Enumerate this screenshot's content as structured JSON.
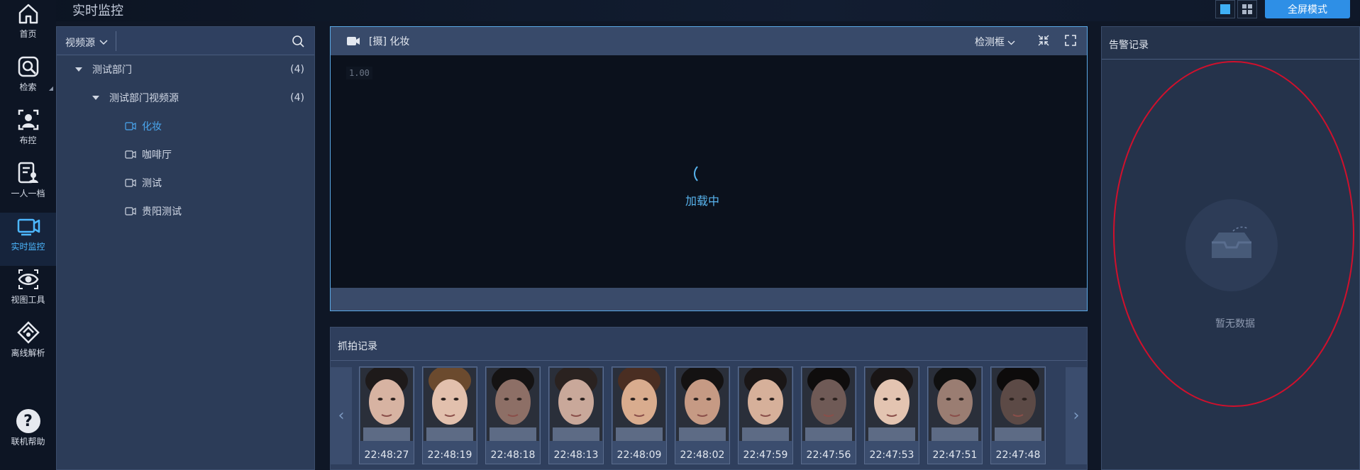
{
  "header": {
    "title": "实时监控",
    "fullscreen_label": "全屏模式",
    "layout_options": [
      "single-view",
      "grid-view"
    ]
  },
  "nav": {
    "items": [
      {
        "label": "首页",
        "icon": "home-icon"
      },
      {
        "label": "检索",
        "icon": "search-face-icon"
      },
      {
        "label": "布控",
        "icon": "deploy-person-icon"
      },
      {
        "label": "一人一档",
        "icon": "person-file-icon"
      },
      {
        "label": "实时监控",
        "icon": "monitor-icon",
        "active": true
      },
      {
        "label": "视图工具",
        "icon": "eye-icon"
      },
      {
        "label": "离线解析",
        "icon": "offline-analysis-icon"
      }
    ],
    "help_label": "联机帮助"
  },
  "tree": {
    "source_dropdown": "视频源",
    "nodes": [
      {
        "label": "测试部门",
        "count": "(4)"
      },
      {
        "label": "测试部门视频源",
        "count": "(4)"
      },
      {
        "label": "化妆"
      },
      {
        "label": "咖啡厅"
      },
      {
        "label": "测试"
      },
      {
        "label": "贵阳测试"
      }
    ]
  },
  "video": {
    "title": "[摄] 化妆",
    "detect_label": "检测框",
    "zoom": "1.00",
    "loading_text": "加载中"
  },
  "capture": {
    "title": "抓拍记录",
    "records": [
      {
        "time": "22:48:27"
      },
      {
        "time": "22:48:19"
      },
      {
        "time": "22:48:18"
      },
      {
        "time": "22:48:13"
      },
      {
        "time": "22:48:09"
      },
      {
        "time": "22:48:02"
      },
      {
        "time": "22:47:59"
      },
      {
        "time": "22:47:56"
      },
      {
        "time": "22:47:53"
      },
      {
        "time": "22:47:51"
      },
      {
        "time": "22:47:48"
      }
    ]
  },
  "alarm": {
    "title": "告警记录",
    "empty_text": "暂无数据"
  },
  "colors": {
    "accent": "#2e8fe6",
    "active_text": "#4db8ff",
    "annotation": "#d0102c"
  }
}
